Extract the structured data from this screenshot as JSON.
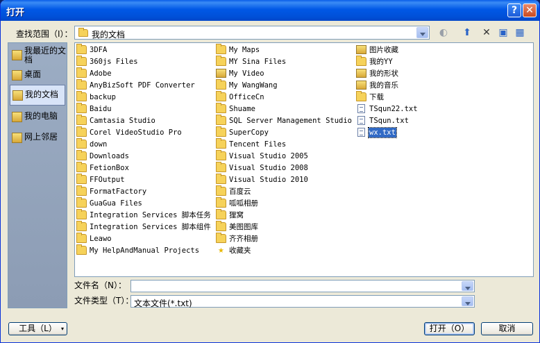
{
  "window": {
    "title": "打开",
    "help_label": "?",
    "close_label": "✕"
  },
  "lookin": {
    "label": "查找范围（I）：",
    "value": "我的文档",
    "icon": "my-documents-icon"
  },
  "toolbar": [
    {
      "name": "back-icon",
      "glyph": "◐"
    },
    {
      "name": "up-folder-icon",
      "glyph": "⬆"
    },
    {
      "name": "delete-icon",
      "glyph": "✕"
    },
    {
      "name": "new-folder-icon",
      "glyph": "▣"
    },
    {
      "name": "views-icon",
      "glyph": "▦"
    }
  ],
  "places": [
    {
      "label": "我最近的文档",
      "icon": "recent-documents-icon",
      "selected": false
    },
    {
      "label": "桌面",
      "icon": "desktop-icon",
      "selected": false
    },
    {
      "label": "我的文档",
      "icon": "my-documents-icon",
      "selected": true
    },
    {
      "label": "我的电脑",
      "icon": "my-computer-icon",
      "selected": false
    },
    {
      "label": "网上邻居",
      "icon": "network-places-icon",
      "selected": false
    }
  ],
  "files": [
    [
      {
        "name": "3DFA",
        "type": "folder"
      },
      {
        "name": "360js Files",
        "type": "folder"
      },
      {
        "name": "Adobe",
        "type": "folder"
      },
      {
        "name": "AnyBizSoft PDF Converter",
        "type": "folder"
      },
      {
        "name": "backup",
        "type": "folder"
      },
      {
        "name": "Baidu",
        "type": "folder"
      },
      {
        "name": "Camtasia Studio",
        "type": "folder"
      },
      {
        "name": "Corel VideoStudio Pro",
        "type": "folder"
      },
      {
        "name": "down",
        "type": "folder"
      },
      {
        "name": "Downloads",
        "type": "folder"
      },
      {
        "name": "FetionBox",
        "type": "folder"
      },
      {
        "name": "FFOutput",
        "type": "folder"
      },
      {
        "name": "FormatFactory",
        "type": "folder"
      },
      {
        "name": "GuaGua Files",
        "type": "folder"
      },
      {
        "name": "Integration Services 脚本任务",
        "type": "folder"
      },
      {
        "name": "Integration Services 脚本组件",
        "type": "folder"
      },
      {
        "name": "Leawo",
        "type": "folder"
      },
      {
        "name": "My HelpAndManual Projects",
        "type": "folder"
      }
    ],
    [
      {
        "name": "My Maps",
        "type": "folder"
      },
      {
        "name": "MY Sina Files",
        "type": "folder"
      },
      {
        "name": "My Video",
        "type": "special"
      },
      {
        "name": "My WangWang",
        "type": "folder"
      },
      {
        "name": "OfficeCn",
        "type": "folder"
      },
      {
        "name": "Shuame",
        "type": "folder"
      },
      {
        "name": "SQL Server Management Studio",
        "type": "folder"
      },
      {
        "name": "SuperCopy",
        "type": "folder"
      },
      {
        "name": "Tencent Files",
        "type": "folder"
      },
      {
        "name": "Visual Studio 2005",
        "type": "folder"
      },
      {
        "name": "Visual Studio 2008",
        "type": "folder"
      },
      {
        "name": "Visual Studio 2010",
        "type": "folder"
      },
      {
        "name": "百度云",
        "type": "folder"
      },
      {
        "name": "呱呱相册",
        "type": "folder"
      },
      {
        "name": "狸窝",
        "type": "folder"
      },
      {
        "name": "美图图库",
        "type": "folder"
      },
      {
        "name": "齐齐相册",
        "type": "folder"
      },
      {
        "name": "收藏夹",
        "type": "favorites"
      }
    ],
    [
      {
        "name": "图片收藏",
        "type": "special"
      },
      {
        "name": "我的YY",
        "type": "folder"
      },
      {
        "name": "我的形状",
        "type": "special"
      },
      {
        "name": "我的音乐",
        "type": "special"
      },
      {
        "name": "下载",
        "type": "folder"
      },
      {
        "name": "TSqun22.txt",
        "type": "text"
      },
      {
        "name": "TSqun.txt",
        "type": "text"
      },
      {
        "name": "wx.txt",
        "type": "text",
        "selected": true
      }
    ]
  ],
  "filename": {
    "label": "文件名（N）：",
    "value": ""
  },
  "filetype": {
    "label": "文件类型（T）：",
    "value": "文本文件(*.txt)"
  },
  "buttons": {
    "tools": "工具（L）",
    "open": "打开（O）",
    "cancel": "取消"
  }
}
